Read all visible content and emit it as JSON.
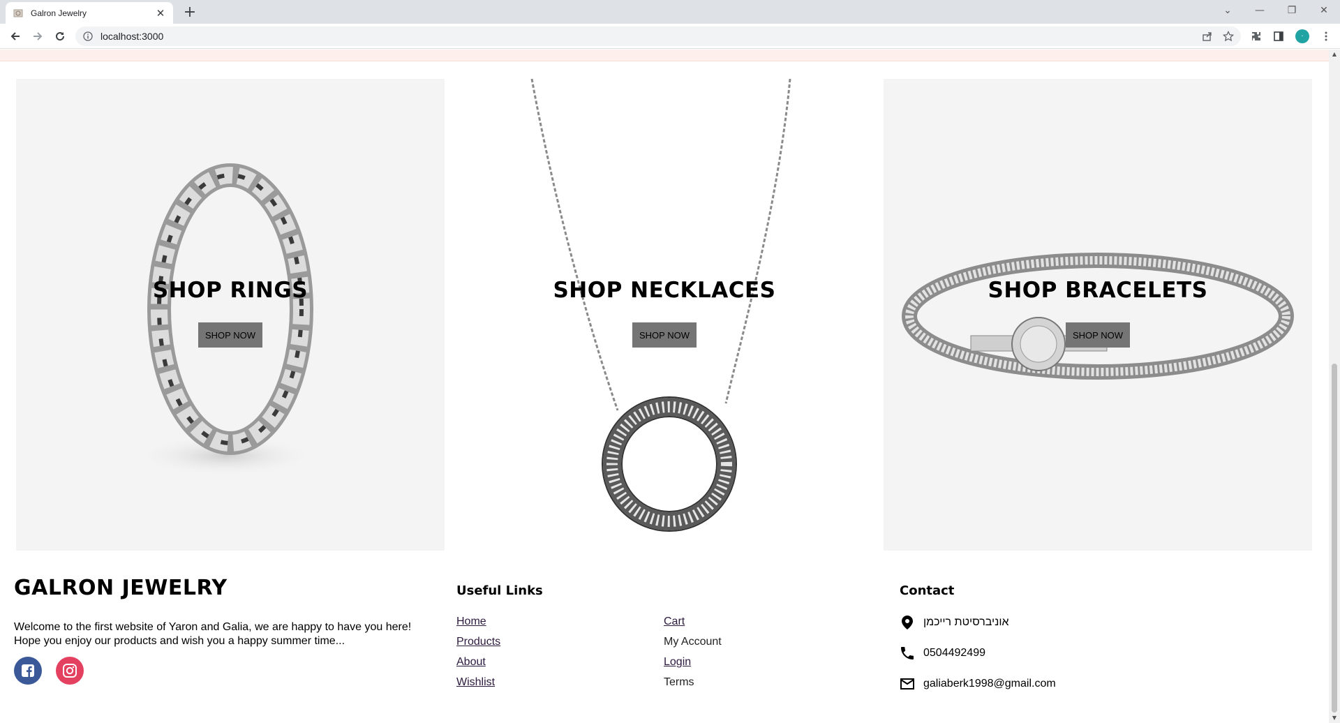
{
  "browser": {
    "tab_title": "Galron Jewelry",
    "url": "localhost:3000",
    "profile_initial": "·"
  },
  "categories": [
    {
      "title": "SHOP RINGS",
      "button": "SHOP NOW"
    },
    {
      "title": "SHOP NECKLACES",
      "button": "SHOP NOW"
    },
    {
      "title": "SHOP BRACELETS",
      "button": "SHOP NOW"
    }
  ],
  "footer": {
    "brand": "GALRON JEWELRY",
    "welcome_line1": "Welcome to the first website of Yaron and Galia, we are happy to have you here!",
    "welcome_line2": "Hope you enjoy our products and wish you a happy summer time...",
    "links_title": "Useful Links",
    "links_left": [
      "Home",
      "Products",
      "About",
      "Wishlist"
    ],
    "links_right": [
      "Cart",
      "My Account",
      "Login",
      "Terms"
    ],
    "contact_title": "Contact",
    "address": "אוניברסיטת רייכמן",
    "phone": "0504492499",
    "email": "galiaberk1998@gmail.com"
  },
  "colors": {
    "facebook": "#3b5998",
    "instagram": "#e4405f",
    "button_bg": "#757575",
    "panel_bg": "#f4f4f4"
  }
}
